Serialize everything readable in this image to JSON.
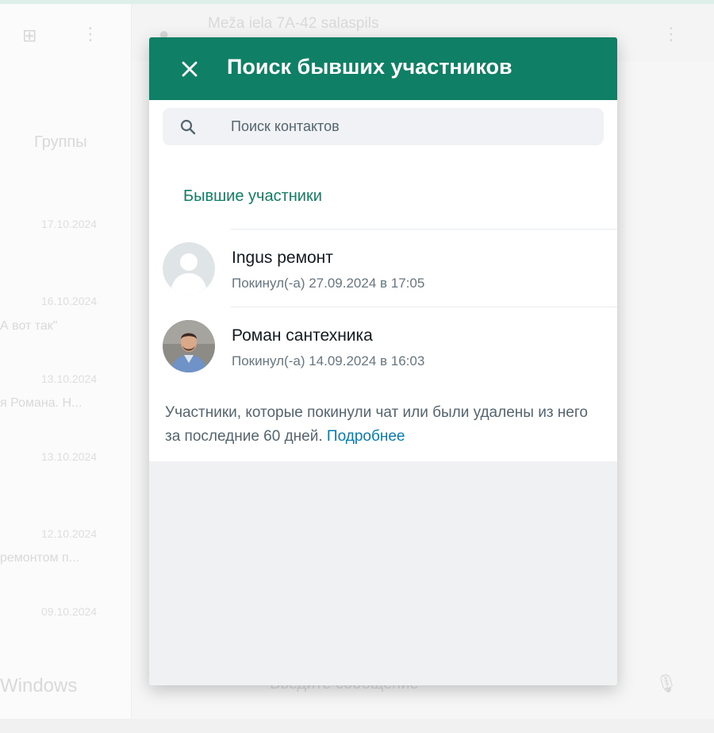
{
  "background": {
    "chat_title": "Meža iela 7A-42 salaspils",
    "tab_groups": "Группы",
    "dates": [
      "17.10.2024",
      "16.10.2024",
      "13.10.2024",
      "13.10.2024",
      "12.10.2024",
      "09.10.2024"
    ],
    "snippets": [
      "А вот так\"",
      "я Романа. Н...",
      "ремонтом п..."
    ],
    "footer_text": "Windows",
    "composer_placeholder": "Введите сообщение"
  },
  "dialog": {
    "title": "Поиск бывших участников",
    "search": {
      "placeholder": "Поиск контактов",
      "value": ""
    },
    "section_title": "Бывшие участники",
    "members": [
      {
        "name": "Ingus ремонт",
        "status": "Покинул(-а) 27.09.2024 в 17:05",
        "avatar": "default-avatar"
      },
      {
        "name": "Роман сантехника",
        "status": "Покинул(-а) 14.09.2024 в 16:03",
        "avatar": "photo-avatar"
      }
    ],
    "info_text": "Участники, которые покинули чат или были удалены из него за последние 60 дней.",
    "info_link": "Подробнее"
  },
  "colors": {
    "header": "#0f8065",
    "accent": "#0f8065",
    "link": "#027eb5",
    "body_bg": "#eff1f2"
  }
}
